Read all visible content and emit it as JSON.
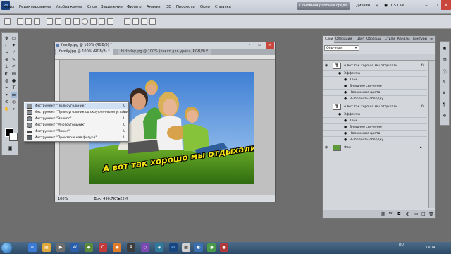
{
  "app": {
    "logo": "Ps"
  },
  "menu": {
    "items": [
      "Файл",
      "Редактирование",
      "Изображение",
      "Слои",
      "Выделение",
      "Фильтр",
      "Анализ",
      "3D",
      "Просмотр",
      "Окно",
      "Справка"
    ],
    "workspace_button": "Основная рабочая среда",
    "design_label": "Дизайн",
    "cs_live": "CS Live"
  },
  "document": {
    "title": "family.jpg @ 100% (RGB/8) *",
    "tabs": [
      {
        "label": "family.jpg @ 100% (RGB/8) *",
        "active": true
      },
      {
        "label": "birthday.jpg @ 100% (текст для урока, RGB/8) *",
        "active": false
      }
    ],
    "zoom": "100%",
    "doc_info": "Док: 490,7K/1,22M",
    "caption": "А вот так хорошо мы отдыхали"
  },
  "flyout": {
    "items": [
      {
        "label": "Инструмент \"Прямоугольник\"",
        "key": "U",
        "selected": true,
        "icon": "rectangle-icon"
      },
      {
        "label": "Инструмент \"Прямоугольник со скругленными углами\"",
        "key": "U",
        "selected": false,
        "icon": "rounded-rectangle-icon"
      },
      {
        "label": "Инструмент \"Эллипс\"",
        "key": "U",
        "selected": false,
        "icon": "ellipse-icon"
      },
      {
        "label": "Инструмент \"Многоугольник\"",
        "key": "U",
        "selected": false,
        "icon": "polygon-icon"
      },
      {
        "label": "Инструмент \"Линия\"",
        "key": "U",
        "selected": false,
        "icon": "line-icon"
      },
      {
        "label": "Инструмент \"Произвольная фигура\"",
        "key": "U",
        "selected": false,
        "icon": "custom-shape-icon"
      }
    ]
  },
  "layers_panel": {
    "tabs": [
      "Слои",
      "Операции",
      "Цвет",
      "Образцы",
      "Стили",
      "Каналы",
      "Контуры"
    ],
    "blend_mode": "Обычные",
    "rows": [
      {
        "type": "layer",
        "name": "А вот так хорошо мы отдыхали",
        "thumb": "T",
        "fx": "fx"
      },
      {
        "type": "effects",
        "name": "Эффекты"
      },
      {
        "type": "effect",
        "name": "Тень"
      },
      {
        "type": "effect",
        "name": "Внешнее свечение"
      },
      {
        "type": "effect",
        "name": "Наложение цвета"
      },
      {
        "type": "effect",
        "name": "Выполнить обводку"
      },
      {
        "type": "layer",
        "name": "А вот так хорошо мы отдыхали",
        "thumb": "T",
        "fx": "fx"
      },
      {
        "type": "effects",
        "name": "Эффекты"
      },
      {
        "type": "effect",
        "name": "Тень"
      },
      {
        "type": "effect",
        "name": "Внешнее свечение"
      },
      {
        "type": "effect",
        "name": "Наложение цвета"
      },
      {
        "type": "effect",
        "name": "Выполнить обводку"
      },
      {
        "type": "layer",
        "name": "Фон",
        "thumb": "img",
        "fx": ""
      }
    ]
  },
  "taskbar": {
    "tray_lang": "RU",
    "tray_time": "14:14"
  }
}
